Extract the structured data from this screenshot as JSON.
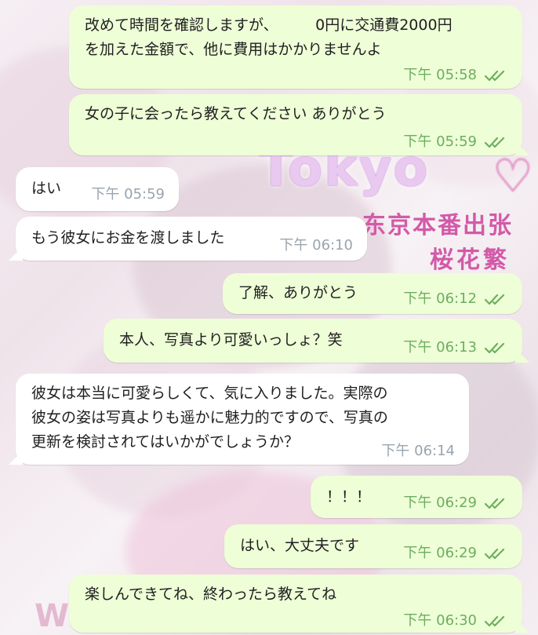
{
  "background": {
    "brand_title": "Tokyo",
    "brand_line1": "东京本番出张",
    "brand_line2": "桜花繁",
    "watermark_letter": "W"
  },
  "messages": [
    {
      "direction": "out",
      "text": "改めて時間を確認しますが、　　　0円に交通費2000円\nを加えた金額で、他に費用はかかりませんよ",
      "time": "下午 05:58",
      "read": true
    },
    {
      "direction": "out",
      "text": "女の子に会ったら教えてください ありがとう",
      "time": "下午 05:59",
      "read": true
    },
    {
      "direction": "in",
      "text": "はい",
      "time": "下午 05:59"
    },
    {
      "direction": "in",
      "text": "もう彼女にお金を渡しました",
      "time": "下午 06:10"
    },
    {
      "direction": "out",
      "text": "了解、ありがとう",
      "time": "下午 06:12",
      "read": true
    },
    {
      "direction": "out",
      "text": "本人、写真より可愛いっしょ？笑",
      "time": "下午 06:13",
      "read": true
    },
    {
      "direction": "in",
      "text": "彼女は本当に可愛らしくて、気に入りました。実際の\n彼女の姿は写真よりも遥かに魅力的ですので、写真の\n更新を検討されてはいかがでしょうか？",
      "time": "下午 06:14"
    },
    {
      "direction": "out",
      "text": "！！！",
      "time": "下午 06:29",
      "read": true
    },
    {
      "direction": "out",
      "text": "はい、大丈夫です",
      "time": "下午 06:29",
      "read": true
    },
    {
      "direction": "out",
      "text": "楽しんできてね、終わったら教えてね",
      "time": "下午 06:30",
      "read": true
    }
  ],
  "colors": {
    "outgoing_bubble": "#eefed7",
    "incoming_bubble": "#ffffff",
    "outgoing_meta": "#6dae5f",
    "incoming_meta": "#9aa4ad"
  },
  "icons": {
    "read_receipt": "double-check-icon"
  }
}
